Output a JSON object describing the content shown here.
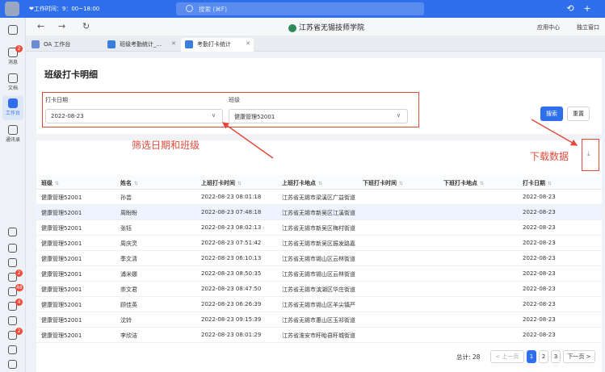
{
  "topbar": {
    "worktime": "❤工作时间：9：00~18:00",
    "search_placeholder": "搜索 (⌘F)"
  },
  "nav": {
    "org_title": "江苏省无锡技师学院",
    "app_center": "应用中心",
    "standalone_window": "独立窗口"
  },
  "rail": {
    "items": [
      {
        "label": "消息",
        "badge": "2"
      },
      {
        "label": "文档"
      },
      {
        "label": "工作台"
      },
      {
        "label": "通讯录"
      }
    ],
    "lower_badges": [
      "2",
      "48",
      "4",
      "2"
    ]
  },
  "tabs": [
    {
      "label": "OA 工作台"
    },
    {
      "label": "班级考勤统计_..."
    },
    {
      "label": "考勤打卡统计"
    }
  ],
  "page": {
    "title": "班级打卡明细",
    "filters": {
      "date_label": "打卡日期",
      "date_value": "2022-08-23",
      "class_label": "班级",
      "class_value": "健康管理52001"
    },
    "search_button": "搜索",
    "reset_button": "重置"
  },
  "annotations": {
    "filter_note": "筛选日期和班级",
    "download_note": "下载数据"
  },
  "table": {
    "headers": [
      "班级",
      "姓名",
      "上班打卡时间",
      "上班打卡地点",
      "下班打卡时间",
      "下班打卡地点",
      "打卡日期"
    ],
    "rows": [
      [
        "健康管理52001",
        "孙芸",
        "2022-08-23 08:01:18",
        "江苏省无锡市梁溪区广益街道",
        "",
        "",
        "2022-08-23"
      ],
      [
        "健康管理52001",
        "周盼盼",
        "2022-08-23 07:48:18",
        "江苏省无锡市新吴区江溪街道",
        "",
        "",
        "2022-08-23"
      ],
      [
        "健康管理52001",
        "张钰",
        "2022-08-23 08:02:13",
        "江苏省无锡市新吴区梅村街道",
        "",
        "",
        "2022-08-23"
      ],
      [
        "健康管理52001",
        "周庆灵",
        "2022-08-23 07:51:42",
        "江苏省无锡市新吴区振发路嘉",
        "",
        "",
        "2022-08-23"
      ],
      [
        "健康管理52001",
        "季文清",
        "2022-08-23 06:10:13",
        "江苏省无锡市锡山区云林街道",
        "",
        "",
        "2022-08-23"
      ],
      [
        "健康管理52001",
        "浦米娜",
        "2022-08-23 08:50:35",
        "江苏省无锡市锡山区云林街道",
        "",
        "",
        "2022-08-23"
      ],
      [
        "健康管理52001",
        "崇文君",
        "2022-08-23 08:47:50",
        "江苏省无锡市滨湖区华庄街道",
        "",
        "",
        "2022-08-23"
      ],
      [
        "健康管理52001",
        "顾佳英",
        "2022-08-23 06:26:39",
        "江苏省无锡市锡山区羊尖镇严",
        "",
        "",
        "2022-08-23"
      ],
      [
        "健康管理52001",
        "沈铃",
        "2022-08-23 09:15:39",
        "江苏省无锡市惠山区玉祁街道",
        "",
        "",
        "2022-08-23"
      ],
      [
        "健康管理52001",
        "李欣洁",
        "2022-08-23 08:01:29",
        "江苏省淮安市盱眙县盱城街道",
        "",
        "",
        "2022-08-23"
      ]
    ]
  },
  "pager": {
    "total": "总计: 28",
    "prev": "< 上一页",
    "pages": [
      "1",
      "2",
      "3"
    ],
    "next": "下一页 >"
  },
  "colors": {
    "accent": "#2f6fec",
    "annotation": "#e24a3b"
  }
}
